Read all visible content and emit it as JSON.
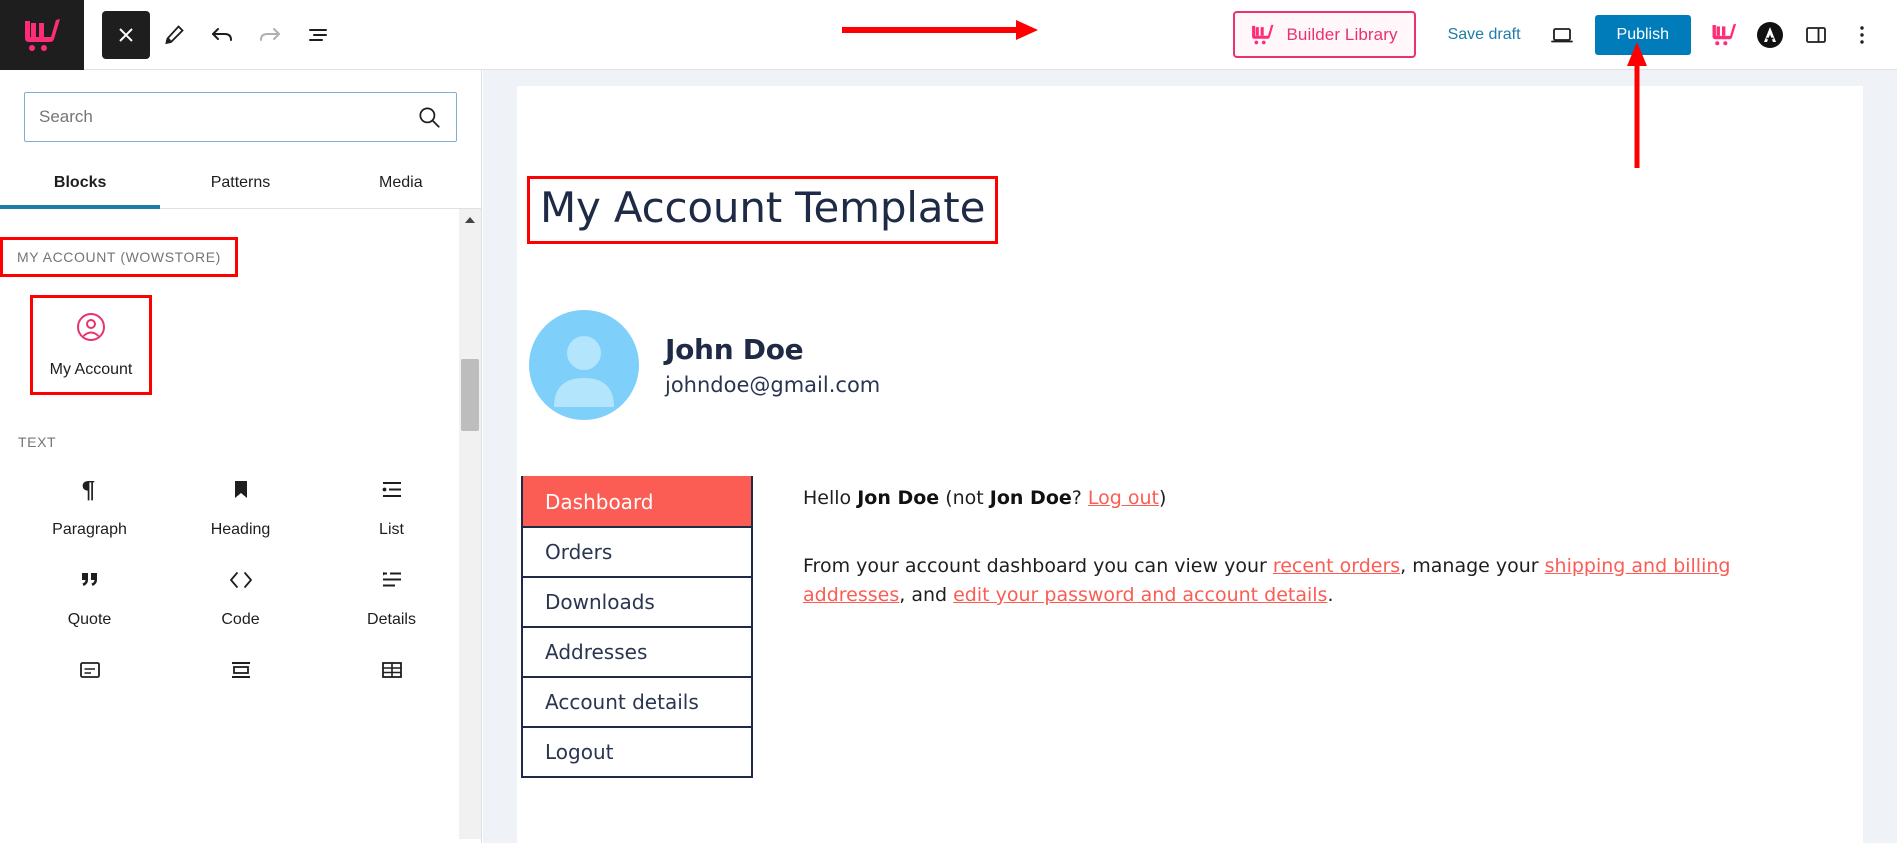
{
  "topbar": {
    "logo_icon": "wowstore-cart-logo",
    "close_label": "close-editor",
    "edit_label": "edit-mode",
    "undo_label": "undo",
    "redo_label": "redo",
    "list_view_label": "document-overview",
    "builder_library_label": "Builder Library",
    "save_draft_label": "Save draft",
    "preview_label": "preview-device",
    "publish_label": "Publish",
    "wowstore_label": "wowstore-settings",
    "astra_label": "astra-settings",
    "sidebar_toggle_label": "settings-sidebar",
    "options_label": "more-options",
    "publish_color": "#007cba",
    "brand_pink": "#e8336d",
    "link_blue": "#1e7ca8"
  },
  "sidebar": {
    "search": {
      "placeholder": "Search",
      "value": ""
    },
    "tabs": [
      {
        "label": "Blocks",
        "active": true
      },
      {
        "label": "Patterns",
        "active": false
      },
      {
        "label": "Media",
        "active": false
      }
    ],
    "categories": [
      {
        "label": "MY ACCOUNT (WOWSTORE)",
        "highlighted": true,
        "blocks": [
          {
            "label": "My Account",
            "icon": "user-circle-icon",
            "highlighted": true
          }
        ]
      },
      {
        "label": "TEXT",
        "highlighted": false,
        "blocks": [
          {
            "label": "Paragraph",
            "icon": "pilcrow-icon"
          },
          {
            "label": "Heading",
            "icon": "bookmark-icon"
          },
          {
            "label": "List",
            "icon": "list-icon"
          },
          {
            "label": "Quote",
            "icon": "quote-icon"
          },
          {
            "label": "Code",
            "icon": "code-icon"
          },
          {
            "label": "Details",
            "icon": "details-icon"
          },
          {
            "label": "",
            "icon": "preformatted-icon"
          },
          {
            "label": "",
            "icon": "pullquote-icon"
          },
          {
            "label": "",
            "icon": "table-icon"
          }
        ]
      }
    ]
  },
  "canvas": {
    "template_title": "My Account Template",
    "user": {
      "name": "John Doe",
      "email": "johndoe@gmail.com",
      "avatar_icon": "user-avatar-icon",
      "avatar_color": "#7ed0fb"
    },
    "account_nav": [
      {
        "label": "Dashboard",
        "active": true
      },
      {
        "label": "Orders",
        "active": false
      },
      {
        "label": "Downloads",
        "active": false
      },
      {
        "label": "Addresses",
        "active": false
      },
      {
        "label": "Account details",
        "active": false
      },
      {
        "label": "Logout",
        "active": false
      }
    ],
    "greeting": {
      "prefix": "Hello ",
      "name1": "Jon Doe",
      "mid": " (not ",
      "name2": "Jon Doe",
      "q": "? ",
      "logout_link": "Log out",
      "suffix": ")"
    },
    "dashboard_text": {
      "p1": "From your account dashboard you can view your ",
      "link1": "recent orders",
      "p2": ", manage your ",
      "link2": "shipping and billing addresses",
      "p3": ", and ",
      "link3": "edit your password and account details",
      "p4": "."
    },
    "active_nav_color": "#fb5c53",
    "link_color": "#fb5c53"
  },
  "annotations": {
    "arrow_to_builder_library": "red-arrow-right",
    "arrow_to_publish": "red-arrow-up",
    "highlight_color": "#ff0000"
  }
}
